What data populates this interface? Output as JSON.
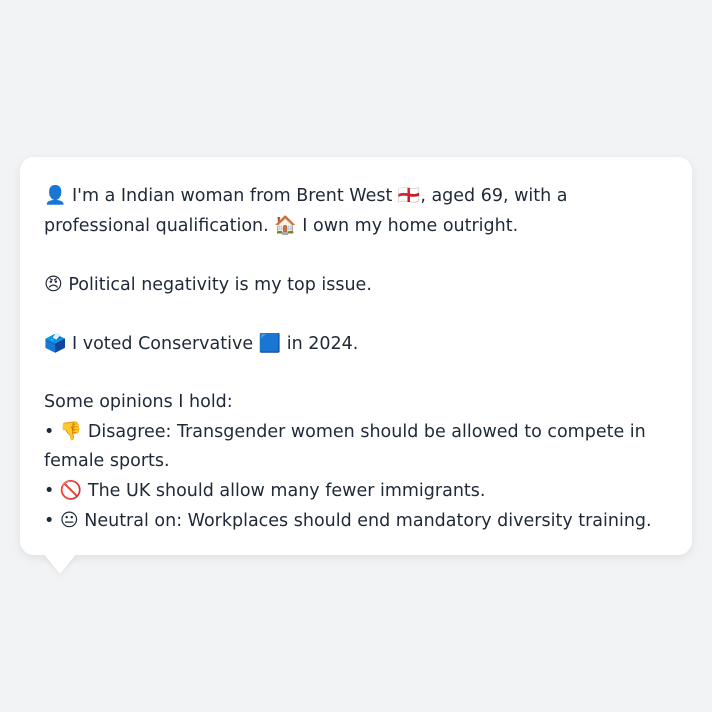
{
  "intro": {
    "person_emoji": "👤",
    "text_a": "I'm a Indian woman from Brent West",
    "flag_emoji": "🏴󠁧󠁢󠁥󠁮󠁧󠁿",
    "text_b": ", aged 69, with a professional qualification.",
    "home_emoji": "🏠",
    "text_c": "I own my home outright."
  },
  "issue": {
    "emoji": "😠",
    "text": "Political negativity is my top issue."
  },
  "vote": {
    "emoji": "🗳️",
    "text_a": "I voted Conservative",
    "party_emoji": "🟦",
    "text_b": "in 2024."
  },
  "opinions": {
    "heading": "Some opinions I hold:",
    "items": [
      {
        "bullet": "•",
        "emoji": "👎",
        "text": "Disagree: Transgender women should be allowed to compete in female sports."
      },
      {
        "bullet": "•",
        "emoji": "🚫",
        "text": "The UK should allow many fewer immigrants."
      },
      {
        "bullet": "•",
        "emoji": "😐",
        "text": "Neutral on: Workplaces should end mandatory diversity training."
      }
    ]
  }
}
